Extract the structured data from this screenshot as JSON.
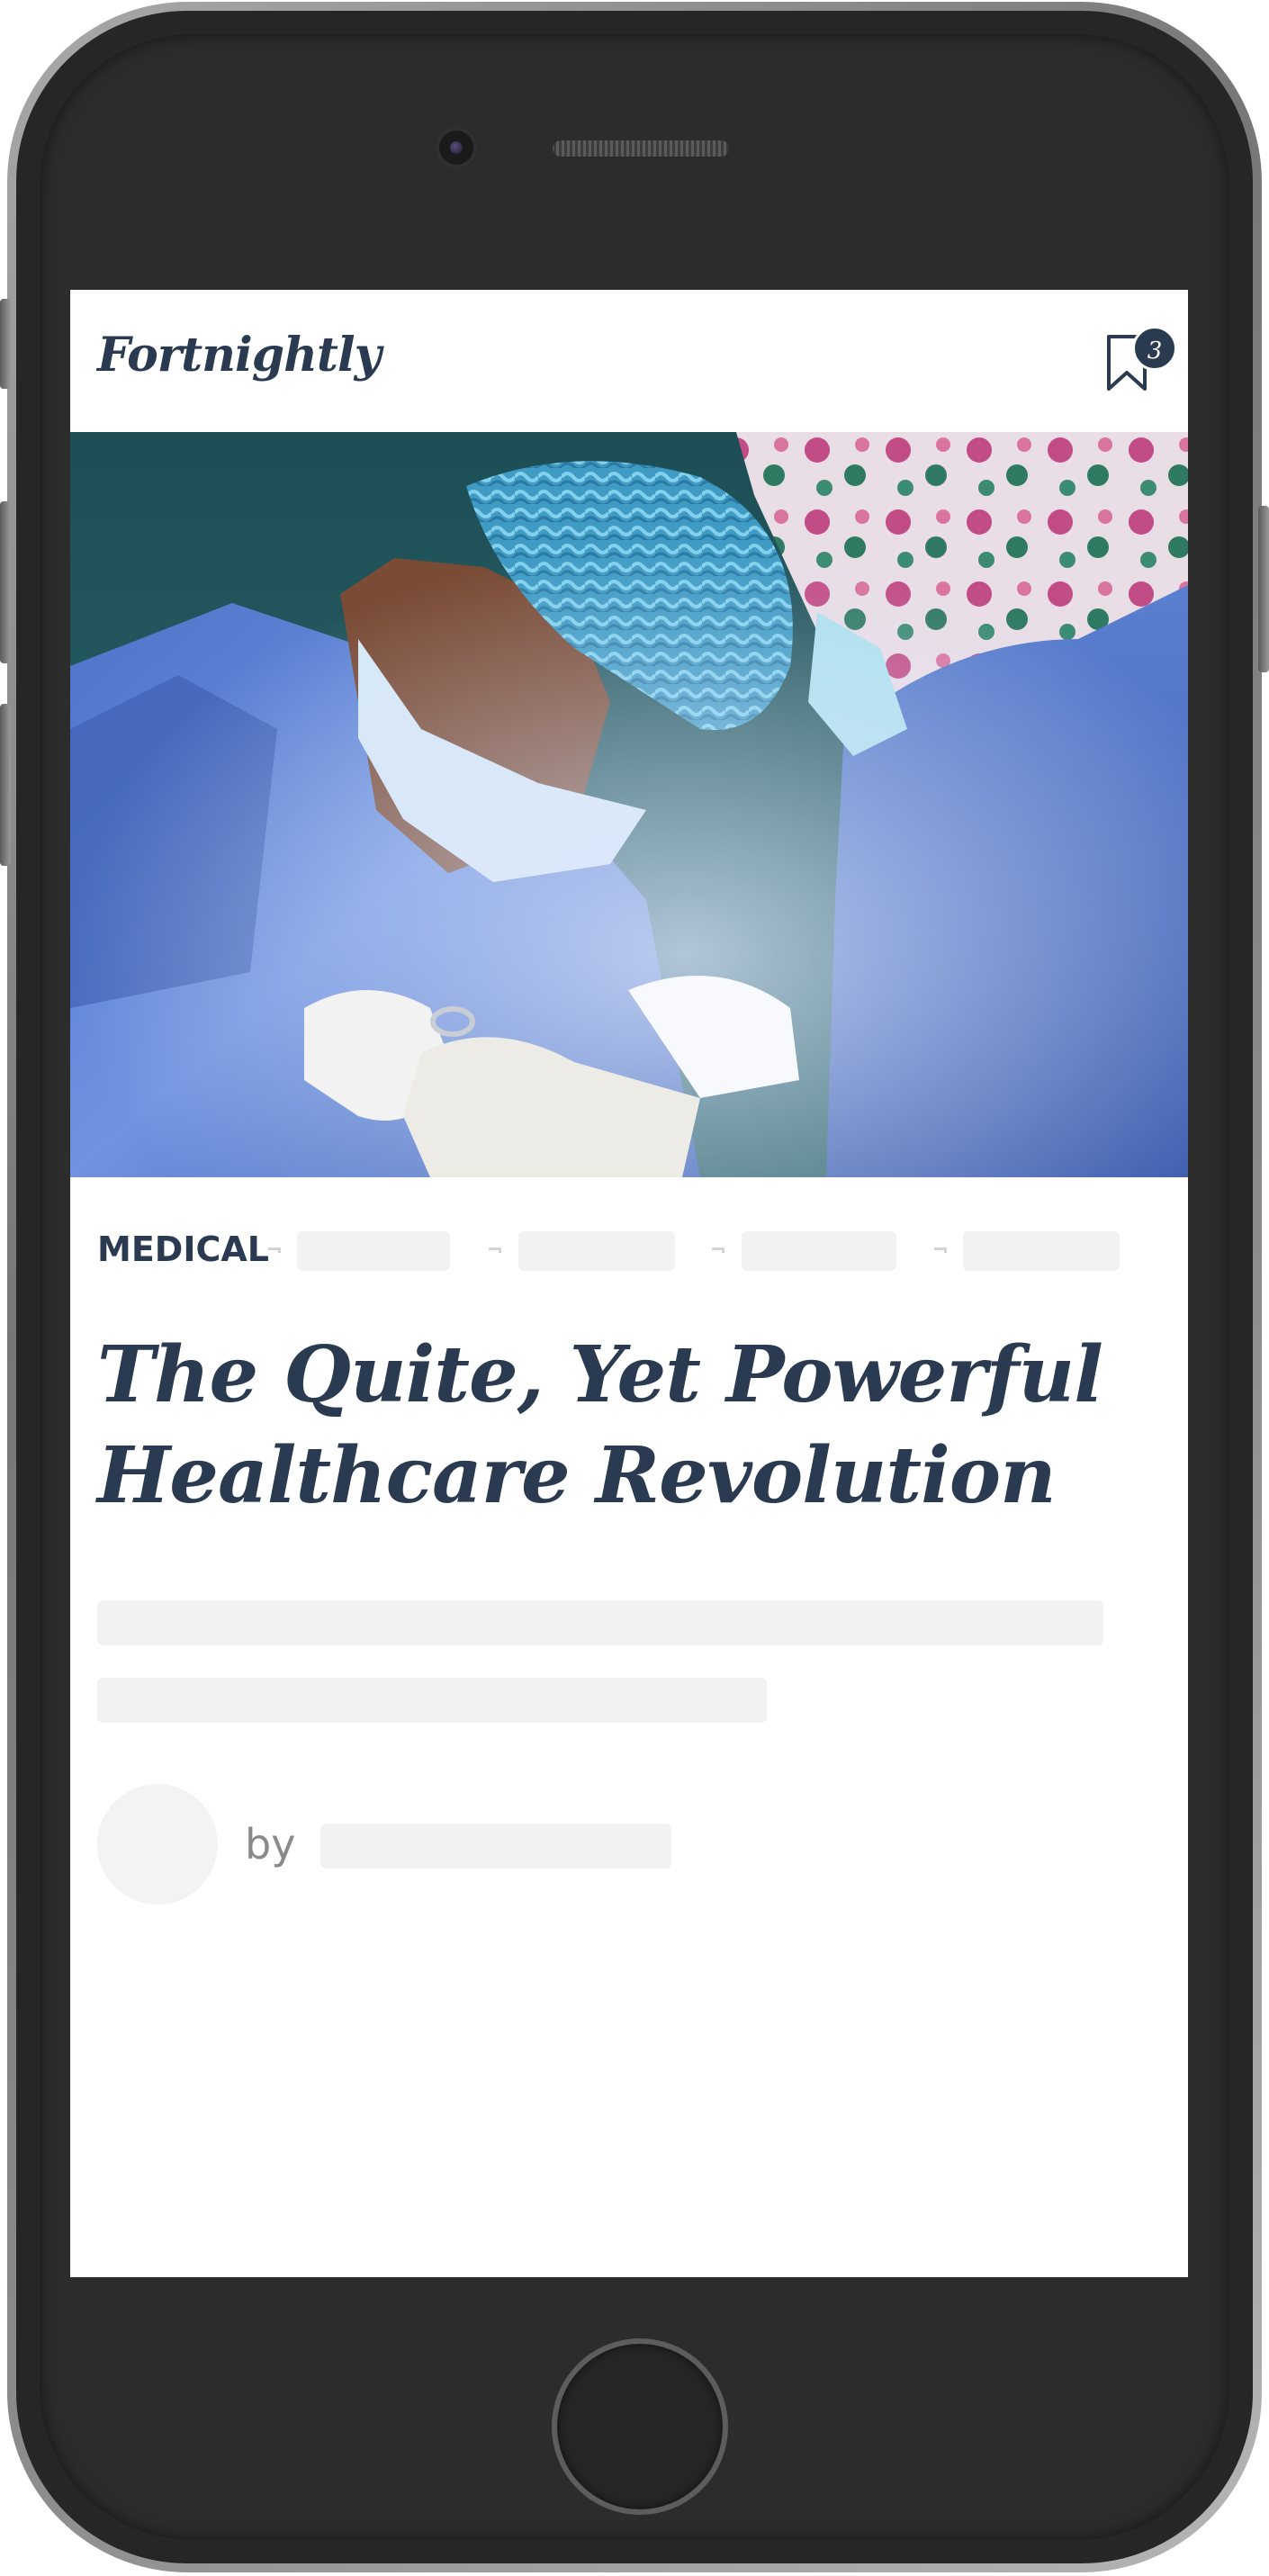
{
  "app": {
    "logo_text": "Fortnightly",
    "bookmark_count": "3"
  },
  "article": {
    "category": "MEDICAL",
    "headline": "The Quite, Yet Powerful Healthcare Revolution",
    "byline_prefix": "by"
  },
  "icons": {
    "bookmark": "bookmark-icon",
    "camera": "camera-icon",
    "speaker": "speaker-icon",
    "home": "home-button-icon"
  },
  "colors": {
    "brand": "#2a3a50",
    "skeleton": "#f2f2f3",
    "device_body": "#262626"
  }
}
